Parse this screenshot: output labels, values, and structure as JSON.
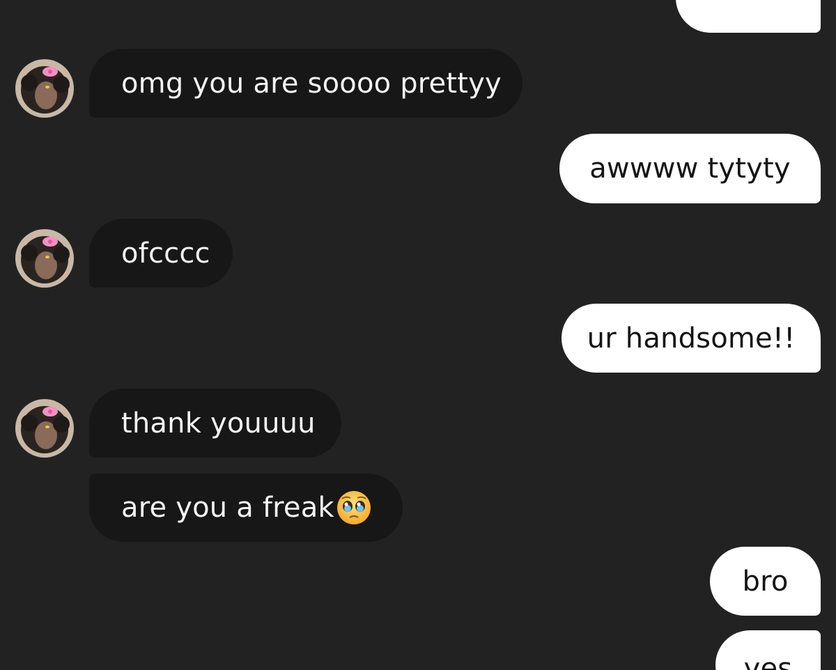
{
  "messages": {
    "m1": "omg you are soooo prettyy",
    "m2": "awwww tytyty",
    "m3": "ofcccc",
    "m4": "ur handsome!!",
    "m5": "thank youuuu",
    "m6": "are you a freak",
    "m7": "bro",
    "m8": "yes"
  },
  "icons": {
    "avatar": "profile-avatar-icon",
    "emoji": "pleading-face-emoji-icon"
  },
  "colors": {
    "background": "#232223",
    "incoming_bubble": "#171717",
    "outgoing_bubble": "#ffffff"
  }
}
